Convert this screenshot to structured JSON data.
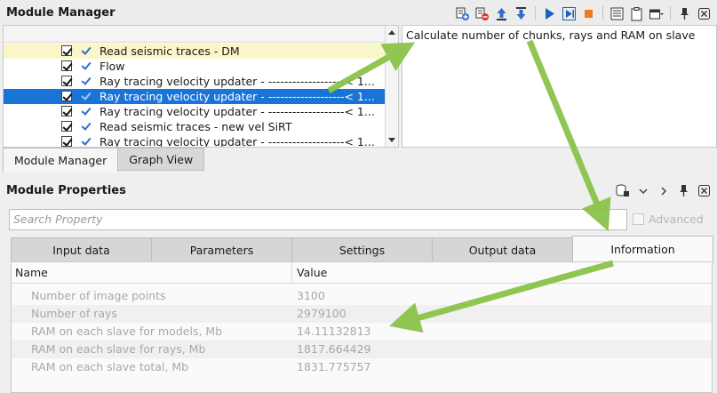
{
  "module_manager": {
    "title": "Module Manager",
    "toolbar_icons": [
      "add-module-icon",
      "remove-module-icon",
      "move-up-icon",
      "move-down-icon",
      "run-icon",
      "run-step-icon",
      "stop-icon",
      "list-icon",
      "clipboard-icon",
      "window-menu-icon",
      "pin-icon",
      "close-icon"
    ],
    "rows": [
      {
        "label": "Read seismic traces - DM",
        "state": "highlight"
      },
      {
        "label": "Flow",
        "state": "normal"
      },
      {
        "label": "Ray tracing velocity updater - -------------------< 1...",
        "state": "normal"
      },
      {
        "label": "Ray tracing velocity updater - -------------------< 1...",
        "state": "selected"
      },
      {
        "label": "Ray tracing velocity updater - -------------------< 1...",
        "state": "normal"
      },
      {
        "label": "Read seismic traces - new vel SiRT",
        "state": "normal"
      },
      {
        "label": "Ray tracing velocity updater - -------------------< 1...",
        "state": "normal"
      }
    ],
    "description": "Calculate number of chunks, rays and RAM on slave",
    "tabs": [
      "Module Manager",
      "Graph View"
    ]
  },
  "module_properties": {
    "title": "Module Properties",
    "search_placeholder": "Search Property",
    "advanced_label": "Advanced",
    "tabs": [
      "Input data",
      "Parameters",
      "Settings",
      "Output data",
      "Information"
    ],
    "active_tab": "Information",
    "columns": [
      "Name",
      "Value"
    ],
    "rows": [
      {
        "name": "Number of image points",
        "value": "3100"
      },
      {
        "name": "Number of rays",
        "value": "2979100"
      },
      {
        "name": "RAM on each slave for models, Mb",
        "value": "14.11132813"
      },
      {
        "name": "RAM on each slave for rays, Mb",
        "value": "1817.664429"
      },
      {
        "name": "RAM on each slave total, Mb",
        "value": "1831.775757"
      }
    ]
  },
  "colors": {
    "selection": "#1a74d8",
    "highlight_row": "#fbf6c9",
    "arrow": "#8bc34a"
  }
}
